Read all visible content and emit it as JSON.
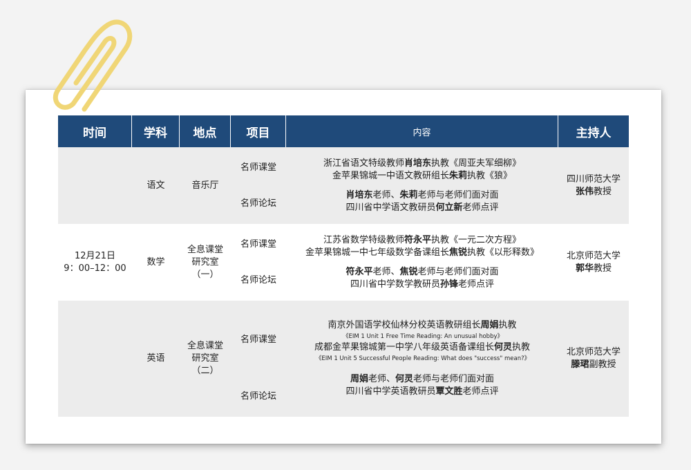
{
  "headers": {
    "time": "时间",
    "subject": "学科",
    "place": "地点",
    "project": "项目",
    "content": "内容",
    "host": "主持人"
  },
  "shared_time": {
    "date": "12月21日",
    "hours": "9：00–12：00"
  },
  "rows": [
    {
      "subject": "语文",
      "place": [
        "音乐厅"
      ],
      "project1": "名师课堂",
      "project2": "名师论坛",
      "c1_pre": "浙江省语文特级教师",
      "c1_bold": "肖培东",
      "c1_post": "执教《周亚夫军细柳》",
      "c2_pre": "金苹果锦城一中语文教研组长",
      "c2_bold": "朱莉",
      "c2_post": "执教《狼》",
      "f1_bold_a": "肖培东",
      "f1_mid": "老师、",
      "f1_bold_b": "朱莉",
      "f1_post": "老师与老师们面对面",
      "f2_pre": "四川省中学语文教研员",
      "f2_bold": "何立新",
      "f2_post": "老师点评",
      "host_org": "四川师范大学",
      "host_bold": "张伟",
      "host_title": "教授"
    },
    {
      "subject": "数学",
      "place": [
        "全息课堂",
        "研究室",
        "（一）"
      ],
      "project1": "名师课堂",
      "project2": "名师论坛",
      "c1_pre": "江苏省数学特级教师",
      "c1_bold": "符永平",
      "c1_post": "执教《一元二次方程》",
      "c2_pre": "金苹果锦城一中七年级数学备课组长",
      "c2_bold": "焦锐",
      "c2_post": "执教《以形释数》",
      "f1_bold_a": "符永平",
      "f1_mid": "老师、",
      "f1_bold_b": "焦锐",
      "f1_post": "老师与老师们面对面",
      "f2_pre": "四川省中学数学教研员",
      "f2_bold": "孙锋",
      "f2_post": "老师点评",
      "host_org": "北京师范大学",
      "host_bold": "郭华",
      "host_title": "教授"
    },
    {
      "subject": "英语",
      "place": [
        "全息课堂",
        "研究室",
        "（二）"
      ],
      "project1": "名师课堂",
      "project2": "名师论坛",
      "c1_pre": "南京外国语学校仙林分校英语教研组长",
      "c1_bold": "周娟",
      "c1_post": "执教",
      "c1_small": "《EIM 1 Unit 1 Free Time   Reading: An unusual hobby》",
      "c2_pre": "成都金苹果锦城第一中学八年级英语备课组长",
      "c2_bold": "何灵",
      "c2_post": "执教",
      "c2_small": "《EIM 1 Unit 5 Successful People  Reading:   What does \"success\" mean?》",
      "f1_bold_a": "周娟",
      "f1_mid": "老师、",
      "f1_bold_b": "何灵",
      "f1_post": "老师与老师们面对面",
      "f2_pre": "四川省中学英语教研员",
      "f2_bold": "覃文胜",
      "f2_post": "老师点评",
      "host_org": "北京师范大学",
      "host_bold": "滕珺",
      "host_title": "副教授"
    }
  ]
}
